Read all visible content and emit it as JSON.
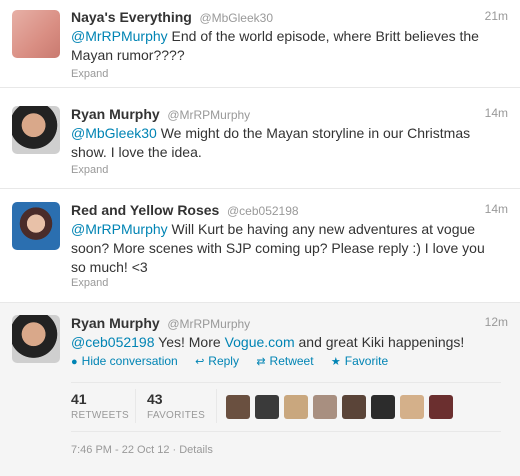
{
  "tweets": [
    {
      "name": "Naya's Everything",
      "username": "@MbGleek30",
      "time": "21m",
      "mention": "@MrRPMurphy",
      "text": " End of the world episode, where Britt believes the Mayan rumor????",
      "expand": "Expand"
    },
    {
      "name": "Ryan Murphy",
      "username": "@MrRPMurphy",
      "time": "14m",
      "mention": "@MbGleek30",
      "text": " We might do the Mayan storyline in our Christmas show. I love the idea.",
      "expand": "Expand"
    },
    {
      "name": "Red and Yellow Roses",
      "username": "@ceb052198",
      "time": "14m",
      "mention": "@MrRPMurphy",
      "text": " Will Kurt be having any new adventures at vogue soon? More scenes with SJP coming up? Please reply :) I love you so much! <3",
      "expand": "Expand"
    },
    {
      "name": "Ryan Murphy",
      "username": "@MrRPMurphy",
      "time": "12m",
      "mention": "@ceb052198",
      "text_a": " Yes! More ",
      "link": "Vogue.com",
      "text_b": " and great Kiki happenings!",
      "actions": {
        "hide": "Hide conversation",
        "reply": "Reply",
        "retweet": "Retweet",
        "favorite": "Favorite"
      },
      "retweets": "41",
      "retweets_label": "RETWEETS",
      "favorites": "43",
      "favorites_label": "FAVORITES",
      "meta": "7:46 PM - 22 Oct 12 · Details"
    }
  ],
  "icons": {
    "hide": "circle-bullet-icon",
    "reply": "reply-arrow-icon",
    "retweet": "retweet-icon",
    "favorite": "star-icon"
  },
  "colors": {
    "link": "#0084b4",
    "muted": "#999999",
    "selected_bg": "#f5f5f5"
  }
}
